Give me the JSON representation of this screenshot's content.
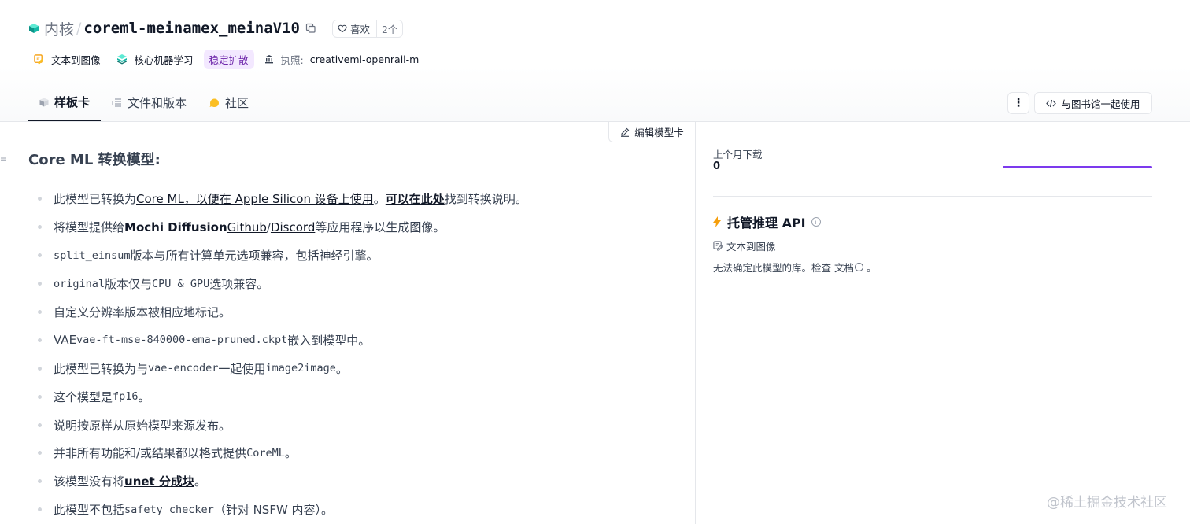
{
  "header": {
    "org": "内核",
    "slash": "/",
    "model_name": "coreml-meinamex_meinaV10",
    "like_label": "喜欢",
    "like_count": "2个"
  },
  "tags": {
    "task": "文本到图像",
    "library": "核心机器学习",
    "category": "稳定扩散",
    "license_label": "执照:",
    "license_value": "creativeml-openrail-m"
  },
  "tabs": [
    {
      "label": "样板卡"
    },
    {
      "label": "文件和版本"
    },
    {
      "label": "社区"
    }
  ],
  "toolbar": {
    "menu_glyph": "⋮",
    "library_button": "与图书馆一起使用",
    "edit_button": "编辑模型卡"
  },
  "content": {
    "title": "Core ML 转换模型:",
    "b1": {
      "pre": "此模型已转换为",
      "link1": "Core ML，以便在 Apple Silicon 设备上使用",
      "mid": "。",
      "link2": "可以在此处",
      "post": "找到转换说明。"
    },
    "b2": {
      "pre": "将模型提供给",
      "bold": "Mochi Diffusion",
      "sp": " ",
      "link1": "Github",
      "sep": " / ",
      "link2": "Discord",
      "post": "等应用程序以生成图像。"
    },
    "b3": {
      "code": "split_einsum",
      "post": "版本与所有计算单元选项兼容，包括神经引擎。"
    },
    "b4": {
      "code": "original",
      "mid": "版本仅与",
      "code2": "CPU & GPU",
      "post": "选项兼容。"
    },
    "b5": {
      "text": "自定义分辨率版本被相应地标记。"
    },
    "b6": {
      "pre": "VAE",
      "code": "vae-ft-mse-840000-ema-pruned.ckpt",
      "post": "嵌入到模型中。"
    },
    "b7": {
      "pre": "此模型已转换为与",
      "code": "vae-encoder",
      "mid": "一起使用",
      "code2": "image2image",
      "post": "。"
    },
    "b8": {
      "pre": "这个模型是",
      "code": "fp16",
      "post": "。"
    },
    "b9": {
      "text": "说明按原样从原始模型来源发布。"
    },
    "b10": {
      "pre": "并非所有功能和/或结果都以格式提供",
      "code": "CoreML",
      "post": "。"
    },
    "b11": {
      "pre": "该模型没有将",
      "link": "unet 分成块",
      "post": "。"
    },
    "b12": {
      "pre": "此模型不包括",
      "code": "safety checker",
      "post": "（针对 NSFW 内容）。"
    }
  },
  "downloads": {
    "label": "上个月下载",
    "value": "0"
  },
  "inference": {
    "title": "托管推理 API",
    "task": "文本到图像",
    "note": "无法确定此模型的库。检查 文档",
    "note_end": " 。"
  },
  "watermark": "@稀土掘金技术社区",
  "colors": {
    "accent_purple": "#7c3aed",
    "tag_purple_bg": "#f3e8ff",
    "api_bolt": "#f59e0b"
  }
}
